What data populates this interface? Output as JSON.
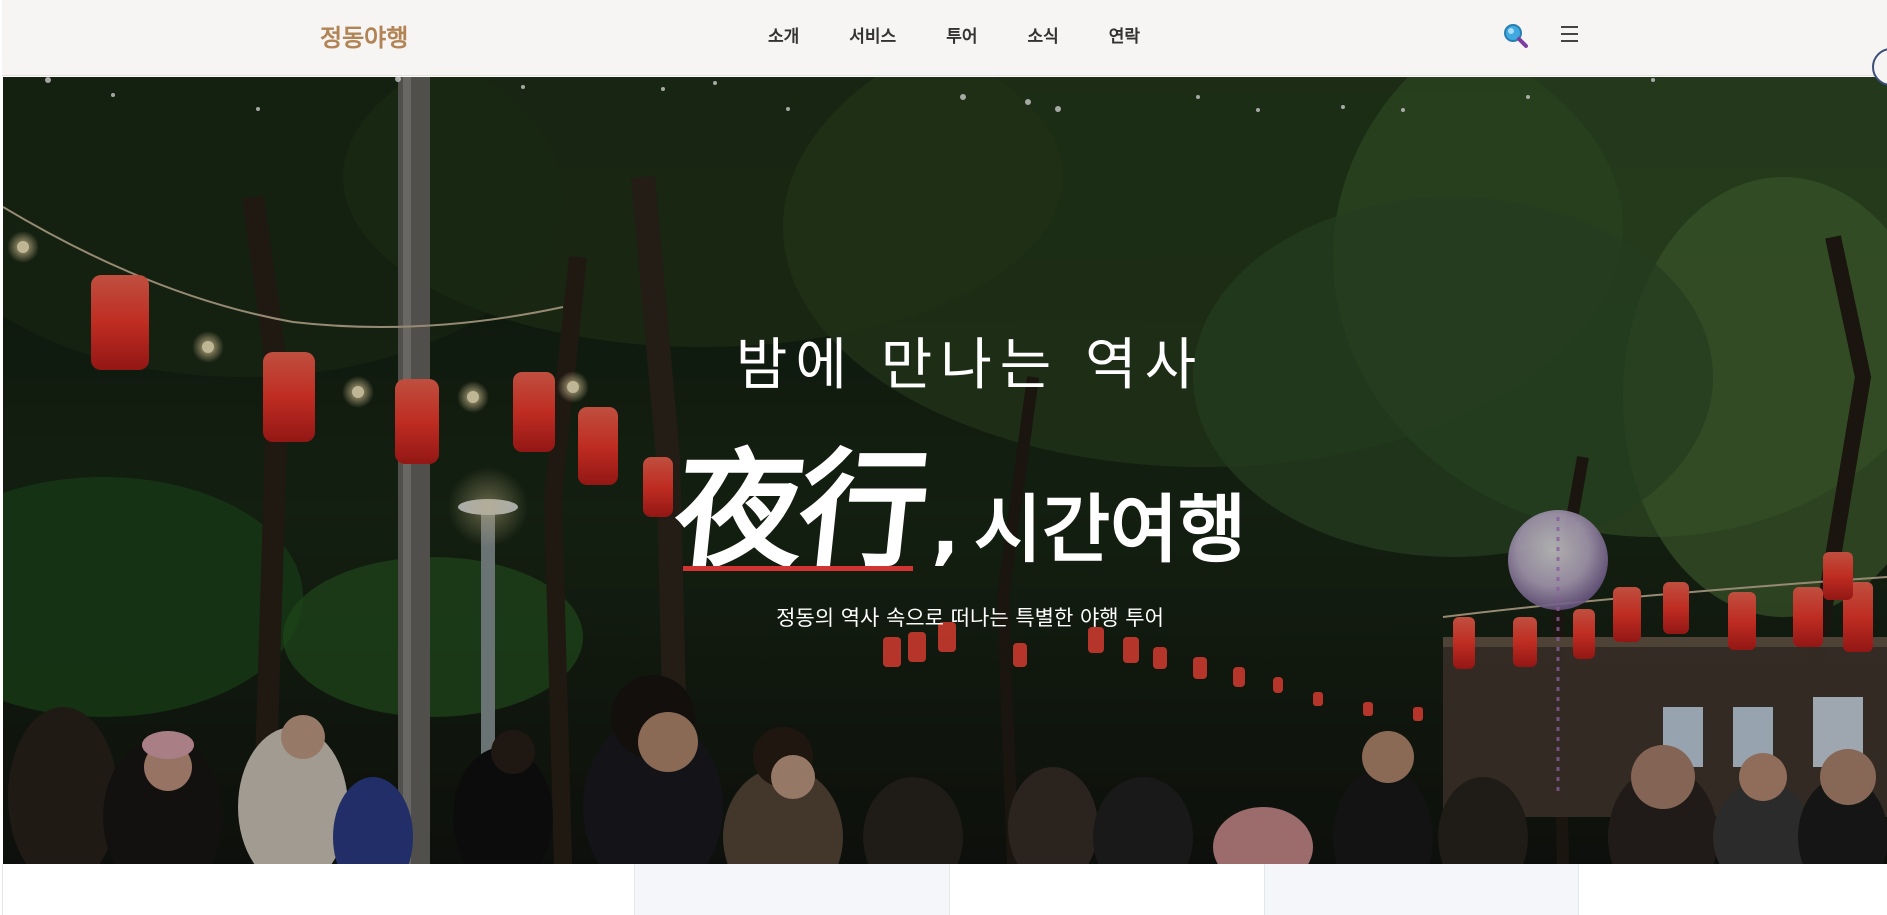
{
  "header": {
    "logo": "정동야행",
    "nav": [
      "소개",
      "서비스",
      "투어",
      "소식",
      "연락"
    ],
    "search_icon": "search-icon",
    "menu_icon": "hamburger-menu-icon"
  },
  "hero": {
    "eyebrow": "밤에 만나는 역사",
    "title_hanja": "夜行",
    "title_comma": ",",
    "title_rest": "시간여행",
    "subtitle": "정동의 역사 속으로 떠나는 특별한 야행 투어",
    "accent_color": "#d13432"
  },
  "colors": {
    "brand": "#b28455",
    "header_bg": "#f7f5f3",
    "lantern": "#e8443a"
  }
}
